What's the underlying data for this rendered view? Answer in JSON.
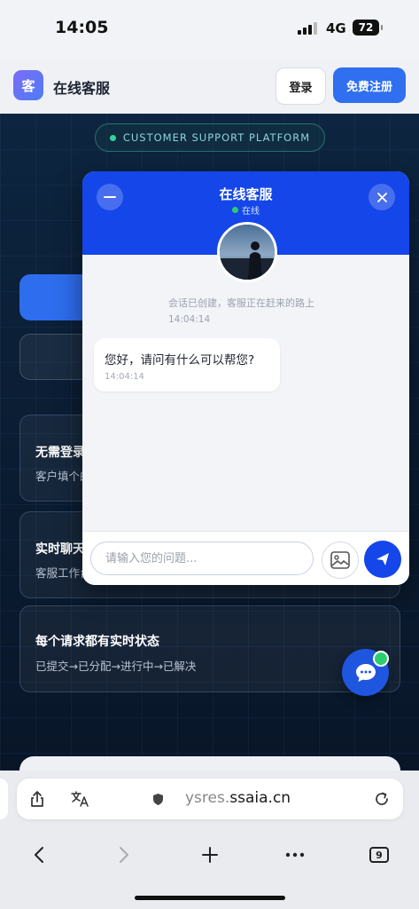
{
  "status_bar": {
    "time": "14:05",
    "network": "4G",
    "battery": "72"
  },
  "header": {
    "logo_char": "客",
    "title": "在线客服",
    "login_label": "登录",
    "register_label": "免费注册"
  },
  "page": {
    "platform_badge": "CUSTOMER SUPPORT PLATFORM",
    "features": [
      {
        "title": "无需登录",
        "desc": "客户填个的"
      },
      {
        "title": "实时聊天",
        "desc": "客服工作台"
      },
      {
        "title": "每个请求都有实时状态",
        "desc": "已提交→已分配→进行中→已解决"
      }
    ]
  },
  "chat": {
    "title": "在线客服",
    "status": "在线",
    "system_message": "会话已创建，客服正在赶来的路上",
    "system_time": "14:04:14",
    "messages": [
      {
        "text": "您好，请问有什么可以帮您?",
        "time": "14:04:14"
      }
    ],
    "input_placeholder": "请输入您的问题...",
    "colors": {
      "primary": "#1446ea",
      "online": "#2ecc71"
    }
  },
  "browser": {
    "url_main": "ysres.",
    "url_domain": "ssaia.cn",
    "tab_count": "9"
  }
}
